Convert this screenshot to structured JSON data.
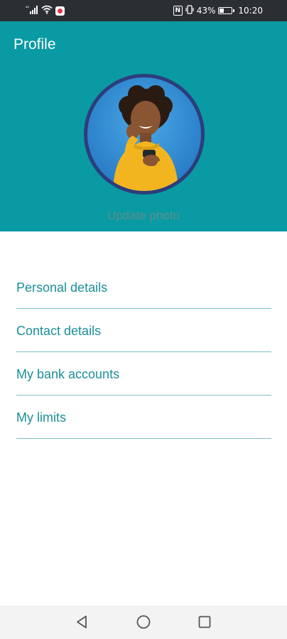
{
  "status_bar": {
    "signal_text": "⁴⁶",
    "nfc_label": "N",
    "battery_percent": "43%",
    "battery_level": 0.43,
    "time": "10:20"
  },
  "header": {
    "title": "Profile",
    "update_photo_label": "Update photo",
    "background_color": "#0a9aa3"
  },
  "menu": {
    "items": [
      {
        "label": "Personal details"
      },
      {
        "label": "Contact details"
      },
      {
        "label": "My bank accounts"
      },
      {
        "label": "My limits"
      }
    ]
  },
  "nav_bar": {
    "buttons": [
      "back-icon",
      "home-icon",
      "recents-icon"
    ]
  }
}
